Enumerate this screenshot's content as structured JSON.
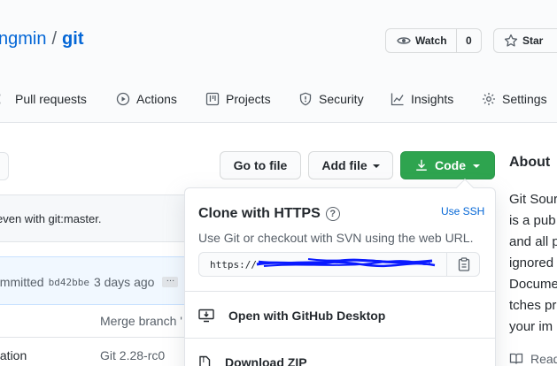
{
  "repo": {
    "owner": "ngmin",
    "separator": "/",
    "name": "git"
  },
  "actions": {
    "watch_label": "Watch",
    "watch_count": "0",
    "star_label": "Star"
  },
  "tabs": [
    {
      "label": "Pull requests",
      "icon": "pull-request-icon"
    },
    {
      "label": "Actions",
      "icon": "play-icon"
    },
    {
      "label": "Projects",
      "icon": "project-icon"
    },
    {
      "label": "Security",
      "icon": "shield-icon"
    },
    {
      "label": "Insights",
      "icon": "graph-icon"
    },
    {
      "label": "Settings",
      "icon": "gear-icon"
    }
  ],
  "toolbar": {
    "goto_file": "Go to file",
    "add_file": "Add file",
    "code": "Code"
  },
  "status": {
    "text": "even with git:master."
  },
  "commit": {
    "prefix": "ommitted",
    "sha": "bd42bbe",
    "when": "3 days ago",
    "more": "…"
  },
  "files": {
    "header_message": "Merge branch '",
    "row_name": "tation",
    "row_message": "Git 2.28-rc0"
  },
  "about": {
    "heading": "About",
    "lines": [
      "Git Sour",
      "is a pub",
      "and all p",
      "ignored",
      "Docume",
      "tches pr",
      "your im"
    ],
    "readme": "Read"
  },
  "clone": {
    "title": "Clone with HTTPS",
    "help": "?",
    "use_ssh": "Use SSH",
    "subtitle": "Use Git or checkout with SVN using the web URL.",
    "url": "https://",
    "open_desktop": "Open with GitHub Desktop",
    "download_zip": "Download ZIP"
  },
  "colors": {
    "link": "#0366d6",
    "primary_green": "#2ea44f",
    "scribble": "#0a1aff"
  }
}
